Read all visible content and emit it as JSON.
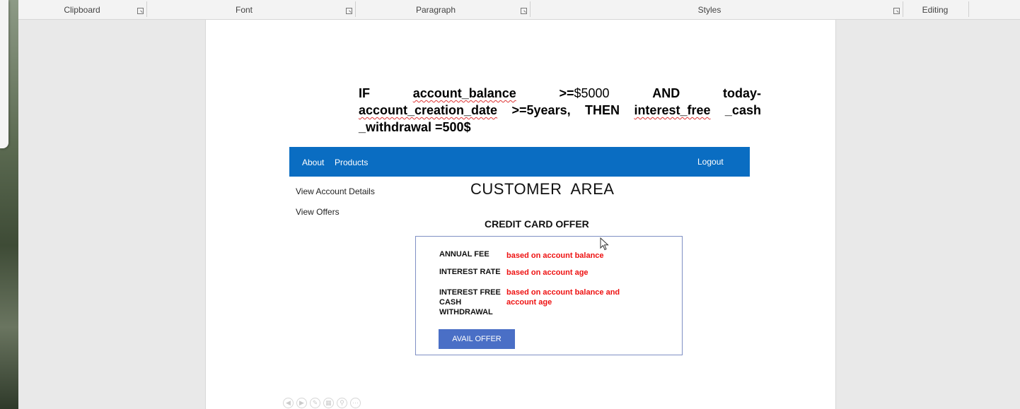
{
  "ribbon": {
    "groups": [
      "Clipboard",
      "Font",
      "Paragraph",
      "Styles",
      "Editing"
    ]
  },
  "document": {
    "rule": {
      "line1": [
        "IF",
        "account_balance",
        ">=",
        "$5000",
        "AND",
        "today-"
      ],
      "line2": [
        "account_creation_date",
        ">=5years,",
        "THEN",
        "interest_free",
        "_cash"
      ],
      "line3": "_withdrawal =500$"
    }
  },
  "mockup": {
    "nav": {
      "about": "About",
      "products": "Products",
      "logout": "Logout"
    },
    "sidebar": {
      "account_details": "View Account Details",
      "offers": "View Offers"
    },
    "title": "CUSTOMER  AREA",
    "offer_title": "CREDIT CARD OFFER",
    "offer": {
      "annual_fee_label": "ANNUAL FEE",
      "annual_fee_value": "based on account balance",
      "interest_rate_label": "INTEREST RATE",
      "interest_rate_value": "based on account age",
      "cash_label": "INTEREST FREE CASH WITHDRAWAL",
      "cash_value": "based on account balance and account age",
      "button": "AVAIL OFFER"
    }
  },
  "colors": {
    "navbar": "#0a6dc2",
    "button": "#4a6fc6",
    "offer_value": "#ee1111"
  },
  "icons": [
    "dialog-launcher-icon",
    "mouse-pointer-icon",
    "slide-nav-icons"
  ]
}
